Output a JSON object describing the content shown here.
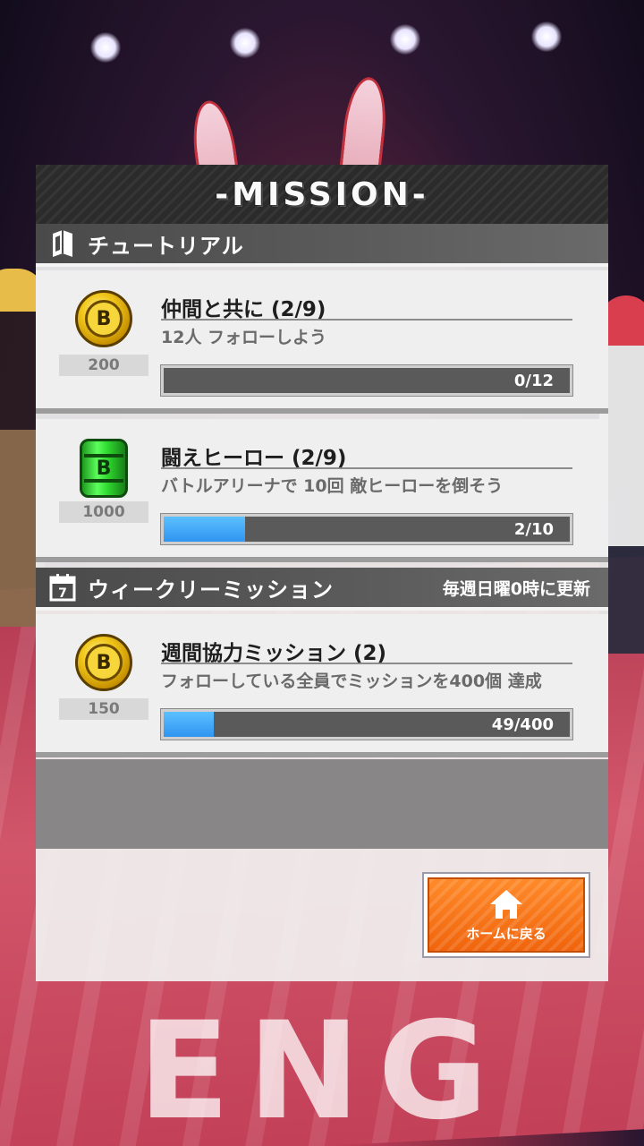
{
  "header": {
    "title": "-MISSION-"
  },
  "sections": {
    "tutorial": {
      "label": "チュートリアル",
      "icon": "book-icon"
    },
    "weekly": {
      "label": "ウィークリーミッション",
      "note": "毎週日曜0時に更新",
      "icon": "calendar-icon",
      "calendar_number": "7"
    }
  },
  "missions": [
    {
      "title": "仲間と共に (2/9)",
      "description": "12人 フォローしよう",
      "reward_icon": "coin-icon",
      "reward_symbol": "B",
      "reward_amount": "200",
      "progress_text": "0/12",
      "progress_fraction": 0
    },
    {
      "title": "闘えヒーロー (2/9)",
      "description": "バトルアリーナで 10回 敵ヒーローを倒そう",
      "reward_icon": "green-can-icon",
      "reward_symbol": "B",
      "reward_amount": "1000",
      "progress_text": "2/10",
      "progress_fraction": 0.2
    },
    {
      "title": "週間協力ミッション (2)",
      "description": "フォローしている全員でミッションを400個 達成",
      "reward_icon": "coin-icon",
      "reward_symbol": "B",
      "reward_amount": "150",
      "progress_text": "49/400",
      "progress_fraction": 0.1225
    }
  ],
  "home_button": {
    "label": "ホームに戻る",
    "icon": "home-icon"
  },
  "background": {
    "floor_text": "ENG"
  },
  "colors": {
    "accent_orange": "#f0640c",
    "progress_blue": "#2f95f0",
    "panel_dark": "#2b2b2b"
  }
}
